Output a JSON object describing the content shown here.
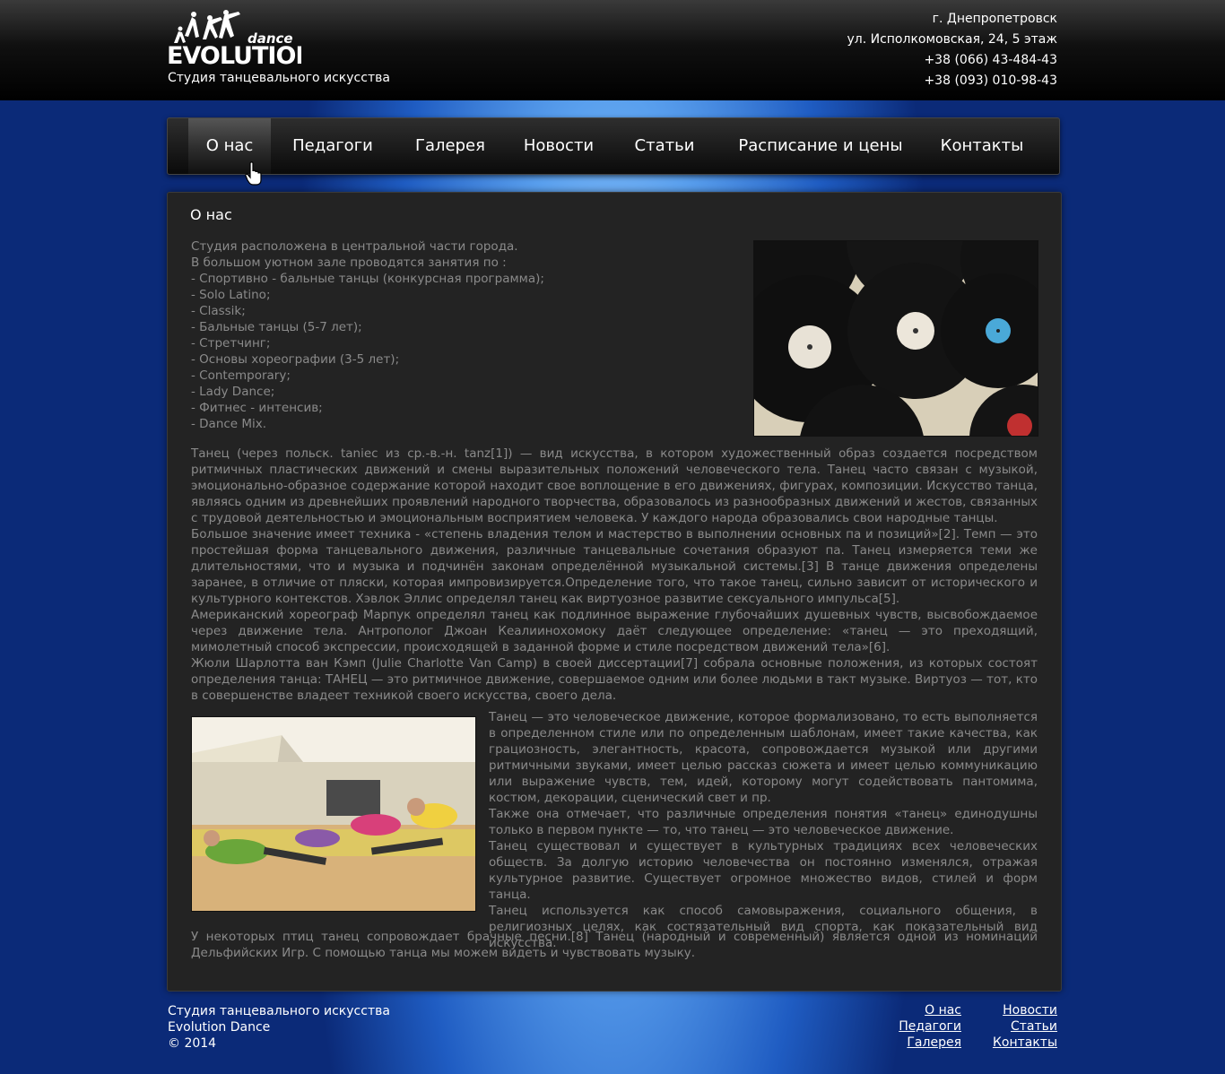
{
  "header": {
    "logo_small": "dance",
    "logo_big": "EVOLUTION",
    "tagline": "Студия танцевального искусства",
    "contacts": [
      "г. Днепропетровск",
      "ул. Исполкомовская, 24, 5 этаж",
      "+38 (066) 43-484-43",
      "+38 (093) 010-98-43"
    ]
  },
  "nav": {
    "items": [
      {
        "label": "О нас",
        "active": true
      },
      {
        "label": "Педагоги"
      },
      {
        "label": "Галерея"
      },
      {
        "label": "Новости"
      },
      {
        "label": "Статьи"
      },
      {
        "label": "Расписание и цены"
      },
      {
        "label": "Контакты"
      }
    ]
  },
  "content": {
    "title": "О нас",
    "intro": [
      "Студия расположена в центральной части города.",
      "В большом уютном зале проводятся занятия по :",
      "- Спортивно - бальные танцы (конкурсная программа);",
      "- Solo Latino;",
      "- Classik;",
      "- Бальные танцы (5-7 лет);",
      "- Стретчинг;",
      "- Основы хореографии (3-5 лет);",
      "- Contemporary;",
      "- Lady Dance;",
      "- Фитнес - интенсив;",
      "- Dance Mix."
    ],
    "paragraphs": [
      "Танец (через польск. taniec из ср.-в.-н. tanz[1]) — вид искусства, в котором художественный образ создается посредством ритмичных пластических движений и смены выразительных положений человеческого тела. Танец часто связан с музыкой, эмоционально-образное содержание которой находит свое воплощение в его движениях, фигурах, композиции. Искусство танца, являясь одним из древнейших проявлений народного творчества, образовалось из разнообразных движений и жестов, связанных с трудовой деятельностью и эмоциональным восприятием человека. У каждого народа образовались свои народные танцы.",
      "Большое значение имеет техника - «степень владения телом и мастерство в выполнении основных па и позиций»[2]. Темп — это простейшая форма танцевального движения, различные танцевальные сочетания образуют па. Танец измеряется теми же длительностями, что и музыка и подчинён законам определённой музыкальной системы.[3] В танце движения определены заранее, в отличие от пляски, которая импровизируется.Определение того, что такое танец, сильно зависит от исторического и культурного контекстов. Хэвлок Эллис определял танец как виртуозное развитие сексуального импульса[5].",
      "Американский хореограф Марпук определял танец как подлинное выражение глубочайших душевных чувств, высвобождаемое через движение тела. Антрополог Джоан Кеалиинохомоку даёт следующее определение: «танец — это преходящий, мимолетный способ экспрессии, происходящей в заданной форме и стиле посредством движений тела»[6].",
      "Жюли Шарлотта ван Кэмп (Julie Charlotte Van Camp) в своей диссертации[7] собрала основные положения, из которых состоят определения танца: ТАНЕЦ — это ритмичное движение, совершаемое одним или более людьми в такт музыке. Виртуоз — тот, кто в совершенстве владеет техникой своего искусства, своего дела."
    ],
    "side_paragraphs": [
      "Танец — это человеческое движение, которое формализовано, то есть выполняется в определенном стиле или по определенным шаблонам, имеет такие качества, как грациозность, элегантность, красота, сопровождается музыкой или другими ритмичными звуками, имеет целью рассказ сюжета и имеет целью коммуникацию или выражение чувств, тем, идей, которому могут содействовать пантомима, костюм, декорации, сценический свет и пр.",
      "Также она отмечает, что различные определения понятия «танец» единодушны только в первом пункте — то, что танец — это человеческое движение.",
      "Танец существовал и существует в культурных традициях всех человеческих обществ. За долгую историю человечества он постоянно изменялся, отражая культурное развитие. Существует огромное множество видов, стилей и форм танца.",
      "Танец используется как способ самовыражения, социального общения, в религиозных целях, как состязательный вид спорта, как показательный вид искусства."
    ],
    "closing": "У некоторых птиц танец сопровождает брачные песни.[8] Танец (народный и современный) является одной из номинаций Дельфийских Игр. С помощью танца мы можем видеть и чувствовать музыку."
  },
  "footer": {
    "lines": [
      "Студия танцевального искусства",
      "Evolution Dance",
      "© 2014"
    ],
    "links_col1": [
      "О нас",
      "Педагоги",
      "Галерея"
    ],
    "links_col2": [
      "Новости",
      "Статьи",
      "Контакты"
    ]
  }
}
